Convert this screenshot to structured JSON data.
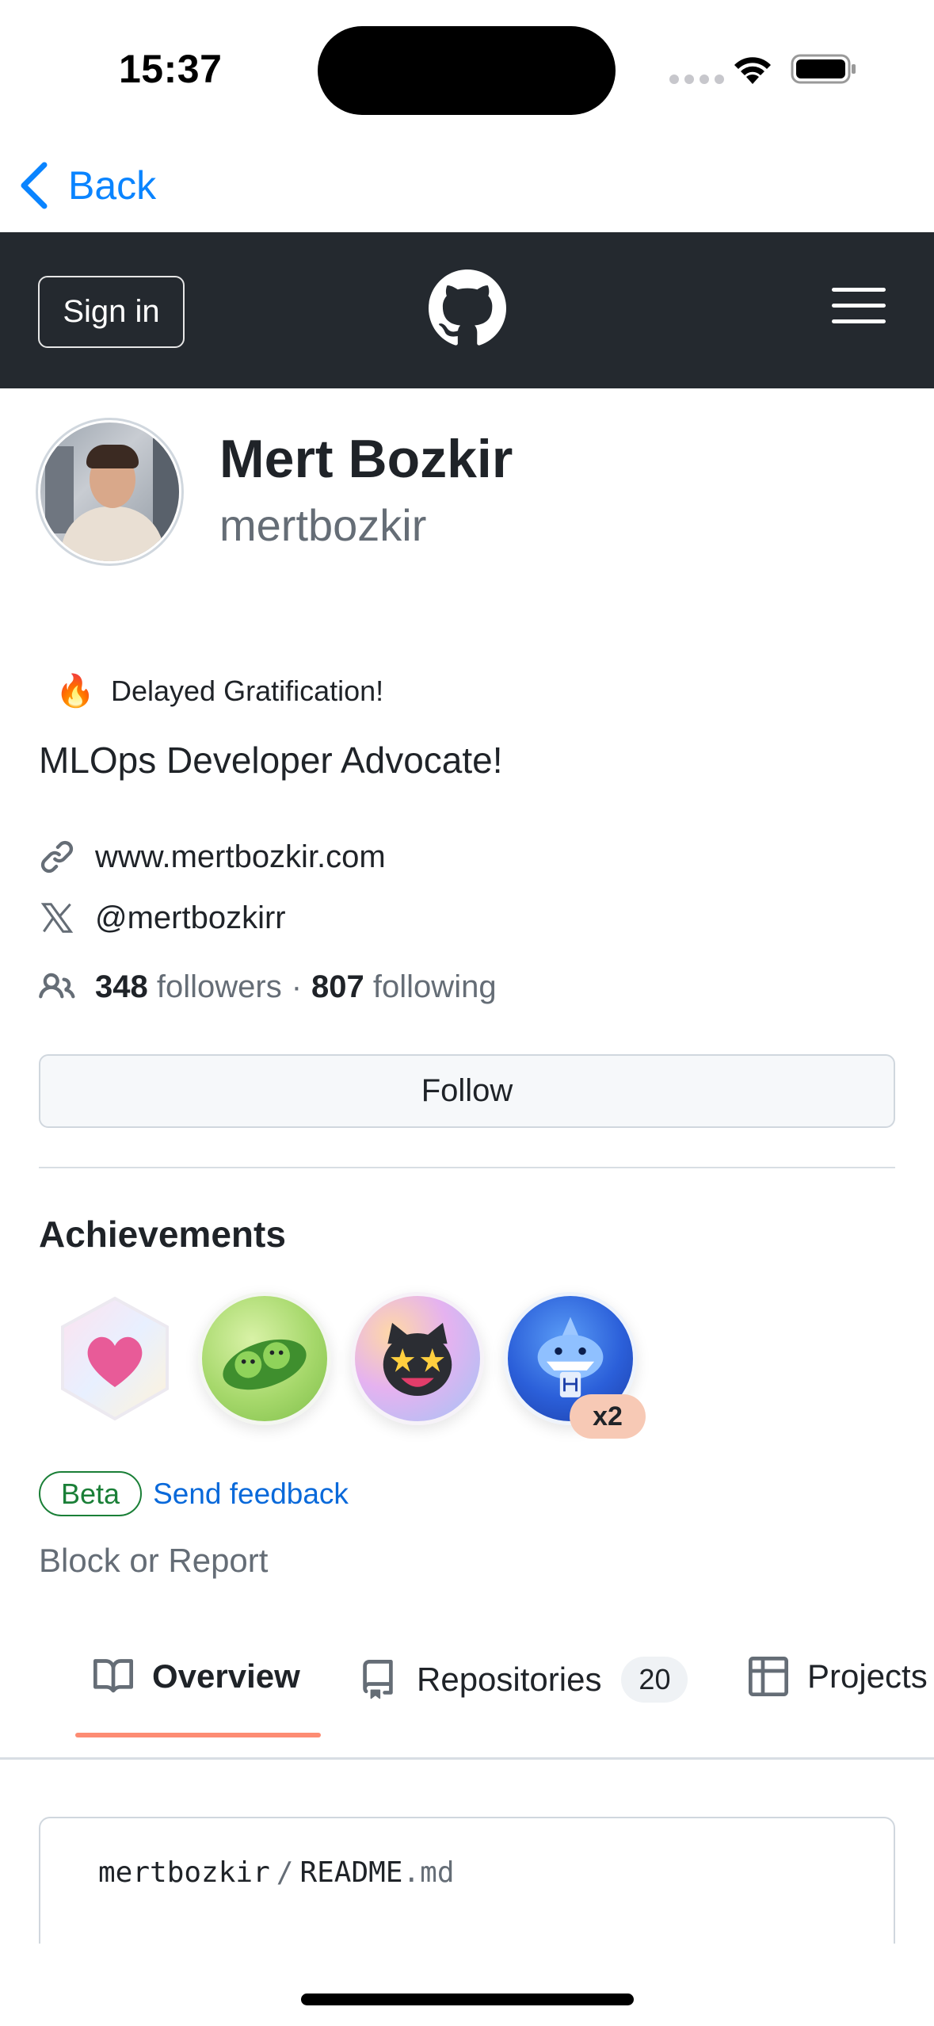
{
  "status_bar": {
    "time": "15:37"
  },
  "nav": {
    "back_label": "Back"
  },
  "header": {
    "sign_in_label": "Sign in"
  },
  "profile": {
    "name": "Mert Bozkir",
    "login": "mertbozkir",
    "status_emoji": "🔥",
    "status_text": "Delayed Gratification!",
    "bio": "MLOps Developer Advocate!",
    "website": "www.mertbozkir.com",
    "twitter": "@mertbozkirr",
    "followers_count": "348",
    "followers_label": "followers",
    "separator": "·",
    "following_count": "807",
    "following_label": "following",
    "follow_button": "Follow"
  },
  "achievements": {
    "title": "Achievements",
    "badges": [
      {
        "icon": "heart-on-sleeve-badge-icon"
      },
      {
        "icon": "pair-extraordinaire-badge-icon"
      },
      {
        "icon": "starstruck-badge-icon"
      },
      {
        "icon": "pull-shark-badge-icon",
        "count": "x2"
      }
    ],
    "beta_label": "Beta",
    "feedback_label": "Send feedback"
  },
  "block_report": "Block or Report",
  "tabs": {
    "overview": "Overview",
    "repositories": "Repositories",
    "repositories_count": "20",
    "projects": "Projects"
  },
  "readme": {
    "owner": "mertbozkir",
    "separator": "/",
    "file_name": "README",
    "file_ext": ".md"
  },
  "colors": {
    "header_bg": "#24292f",
    "link_blue": "#0969da",
    "ios_blue": "#0a84ff",
    "tab_underline": "#fd8c73",
    "beta_green": "#1a7f37"
  }
}
